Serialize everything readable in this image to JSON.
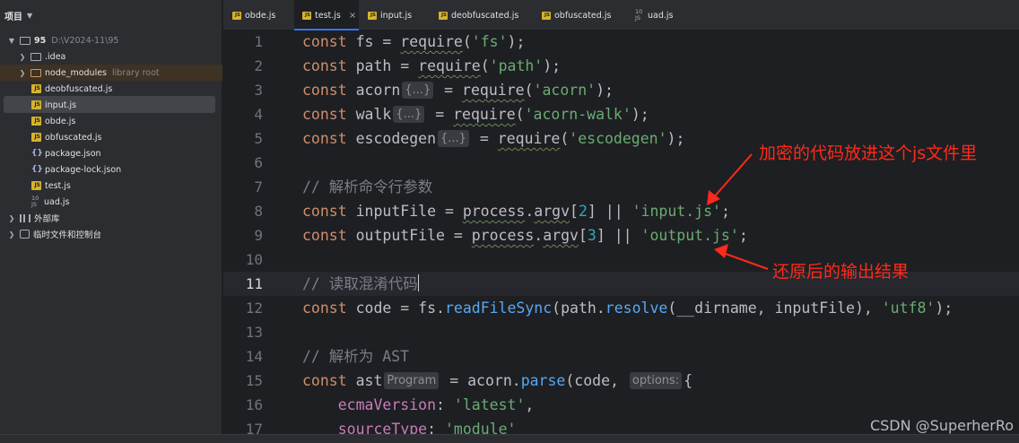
{
  "sidebar": {
    "title": "项目",
    "tree": [
      {
        "label": "95",
        "hint": "D:\\V2024-11\\95",
        "icon": "folder-icon",
        "expanded": true
      },
      {
        "label": ".idea",
        "icon": "folder-icon",
        "expanded": false
      },
      {
        "label": "node_modules",
        "hint": "library root",
        "icon": "folder-icon",
        "expanded": false
      },
      {
        "label": "deobfuscated.js",
        "icon": "js-file-icon"
      },
      {
        "label": "input.js",
        "icon": "js-file-icon",
        "selected": true
      },
      {
        "label": "obde.js",
        "icon": "js-file-icon"
      },
      {
        "label": "obfuscated.js",
        "icon": "js-file-icon"
      },
      {
        "label": "package.json",
        "icon": "json-file-icon"
      },
      {
        "label": "package-lock.json",
        "icon": "json-file-icon"
      },
      {
        "label": "test.js",
        "icon": "js-file-icon"
      },
      {
        "label": "uad.js",
        "icon": "js-test-file-icon"
      },
      {
        "label": "外部库",
        "icon": "library-icon",
        "expanded": false
      },
      {
        "label": "临时文件和控制台",
        "icon": "scratch-icon",
        "expanded": false
      }
    ]
  },
  "tabs": [
    {
      "label": "obde.js",
      "active": false
    },
    {
      "label": "test.js",
      "active": true,
      "close": "×"
    },
    {
      "label": "input.js",
      "active": false
    },
    {
      "label": "deobfuscated.js",
      "active": false
    },
    {
      "label": "obfuscated.js",
      "active": false
    },
    {
      "label": "uad.js",
      "active": false
    }
  ],
  "editor": {
    "line_numbers": [
      "1",
      "2",
      "3",
      "4",
      "5",
      "6",
      "7",
      "8",
      "9",
      "10",
      "11",
      "12",
      "13",
      "14",
      "15",
      "16",
      "17"
    ],
    "current_line": "11",
    "inlay_hints": {
      "collapsed": "{...}",
      "program": "Program",
      "options": "options:"
    },
    "lines": {
      "l1": {
        "kw": "const",
        "a": " fs = ",
        "req": "require",
        "b": "(",
        "s": "'fs'",
        "c": ");"
      },
      "l2": {
        "kw": "const",
        "a": " path = ",
        "req": "require",
        "b": "(",
        "s": "'path'",
        "c": ");"
      },
      "l3": {
        "kw": "const",
        "a": " acorn",
        "eq": " = ",
        "req": "require",
        "b": "(",
        "s": "'acorn'",
        "c": ");"
      },
      "l4": {
        "kw": "const",
        "a": " walk",
        "eq": " = ",
        "req": "require",
        "b": "(",
        "s": "'acorn-walk'",
        "c": ");"
      },
      "l5": {
        "kw": "const",
        "a": " escodegen",
        "eq": " = ",
        "req": "require",
        "b": "(",
        "s": "'escodegen'",
        "c": ");"
      },
      "l7": {
        "cmt": "// 解析命令行参数"
      },
      "l8": {
        "kw": "const",
        "a": " inputFile = ",
        "obj": "process",
        "dot": ".",
        "prop": "argv",
        "b": "[",
        "n": "2",
        "c": "] || ",
        "s": "'input.js'",
        "d": ";"
      },
      "l9": {
        "kw": "const",
        "a": " outputFile = ",
        "obj": "process",
        "dot": ".",
        "prop": "argv",
        "b": "[",
        "n": "3",
        "c": "] || ",
        "s": "'output.js'",
        "d": ";"
      },
      "l11": {
        "cmt": "// 读取混淆代码"
      },
      "l12": {
        "kw": "const",
        "a": " code = fs.",
        "fn": "readFileSync",
        "b": "(path.",
        "fn2": "resolve",
        "c": "(__dirname, inputFile), ",
        "s": "'utf8'",
        "d": ");"
      },
      "l14": {
        "cmt": "// 解析为 AST"
      },
      "l15": {
        "kw": "const",
        "a": " ast",
        "eq": " = acorn.",
        "fn": "parse",
        "b": "(code, ",
        "c": "{"
      },
      "l16": {
        "indent": "    ",
        "prop": "ecmaVersion",
        "a": ": ",
        "s": "'latest'",
        "c": ","
      },
      "l17": {
        "indent": "    ",
        "prop": "sourceType",
        "a": ": ",
        "s": "'module'"
      }
    }
  },
  "annotations": {
    "encrypted_note": "加密的代码放进这个js文件里",
    "restored_note": "还原后的输出结果",
    "color": "#ff2a1a"
  },
  "watermark": "CSDN @SuperherRo"
}
